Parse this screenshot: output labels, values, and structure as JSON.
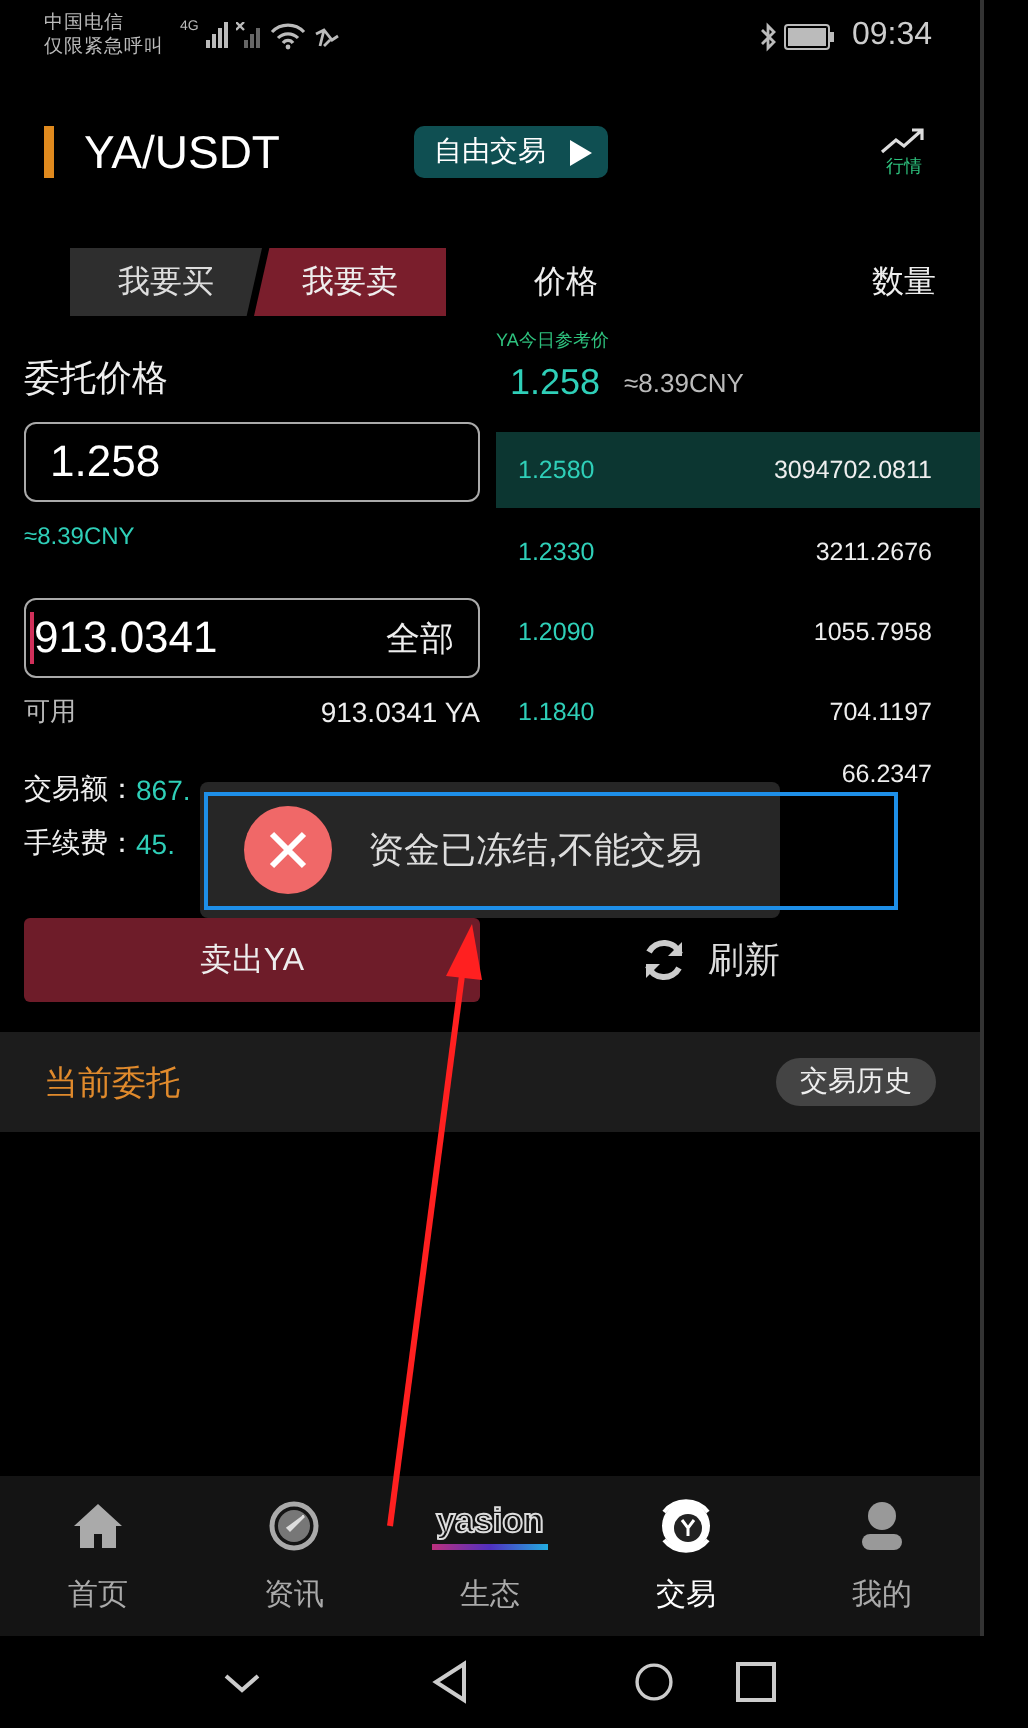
{
  "status_bar": {
    "carrier": "中国电信",
    "carrier_note": "仅限紧急呼叫",
    "network": "4G",
    "time": "09:34"
  },
  "header": {
    "title": "YA/USDT",
    "mode_button": "自由交易",
    "market_link": "行情"
  },
  "side_tabs": [
    {
      "label": "我要买",
      "selected": false
    },
    {
      "label": "我要卖",
      "selected": true
    }
  ],
  "order_form": {
    "price_label": "委托价格",
    "price_value": "1.258",
    "price_cny": "≈8.39CNY",
    "amount_value": "913.0341",
    "amount_focused": true,
    "all_button": "全部",
    "available_label": "可用",
    "available_value": "913.0341 YA",
    "trade_amount_label": "交易额：",
    "trade_amount_value": "867.",
    "fee_label": "手续费：",
    "fee_value": "45.",
    "submit_button": "卖出YA",
    "refresh_button": "刷新"
  },
  "order_book": {
    "columns": [
      "价格",
      "数量"
    ],
    "reference_label": "YA今日参考价",
    "reference_price": "1.258",
    "reference_cny": "≈8.39CNY",
    "rows": [
      {
        "price": "1.2580",
        "quantity": "3094702.0811",
        "selected": true
      },
      {
        "price": "1.2330",
        "quantity": "3211.2676",
        "selected": false
      },
      {
        "price": "1.2090",
        "quantity": "1055.7958",
        "selected": false
      },
      {
        "price": "1.1840",
        "quantity": "704.1197",
        "selected": false
      },
      {
        "quantity": "66.2347",
        "selected": false
      }
    ]
  },
  "current_orders": {
    "title": "当前委托",
    "history_button": "交易历史"
  },
  "toast": {
    "message": "资金已冻结,不能交易"
  },
  "tab_bar": {
    "items": [
      {
        "label": "首页",
        "selected": false
      },
      {
        "label": "资讯",
        "selected": false
      },
      {
        "label": "生态",
        "selected": false,
        "logo": "yasion"
      },
      {
        "label": "交易",
        "selected": true
      },
      {
        "label": "我的",
        "selected": false
      }
    ]
  }
}
